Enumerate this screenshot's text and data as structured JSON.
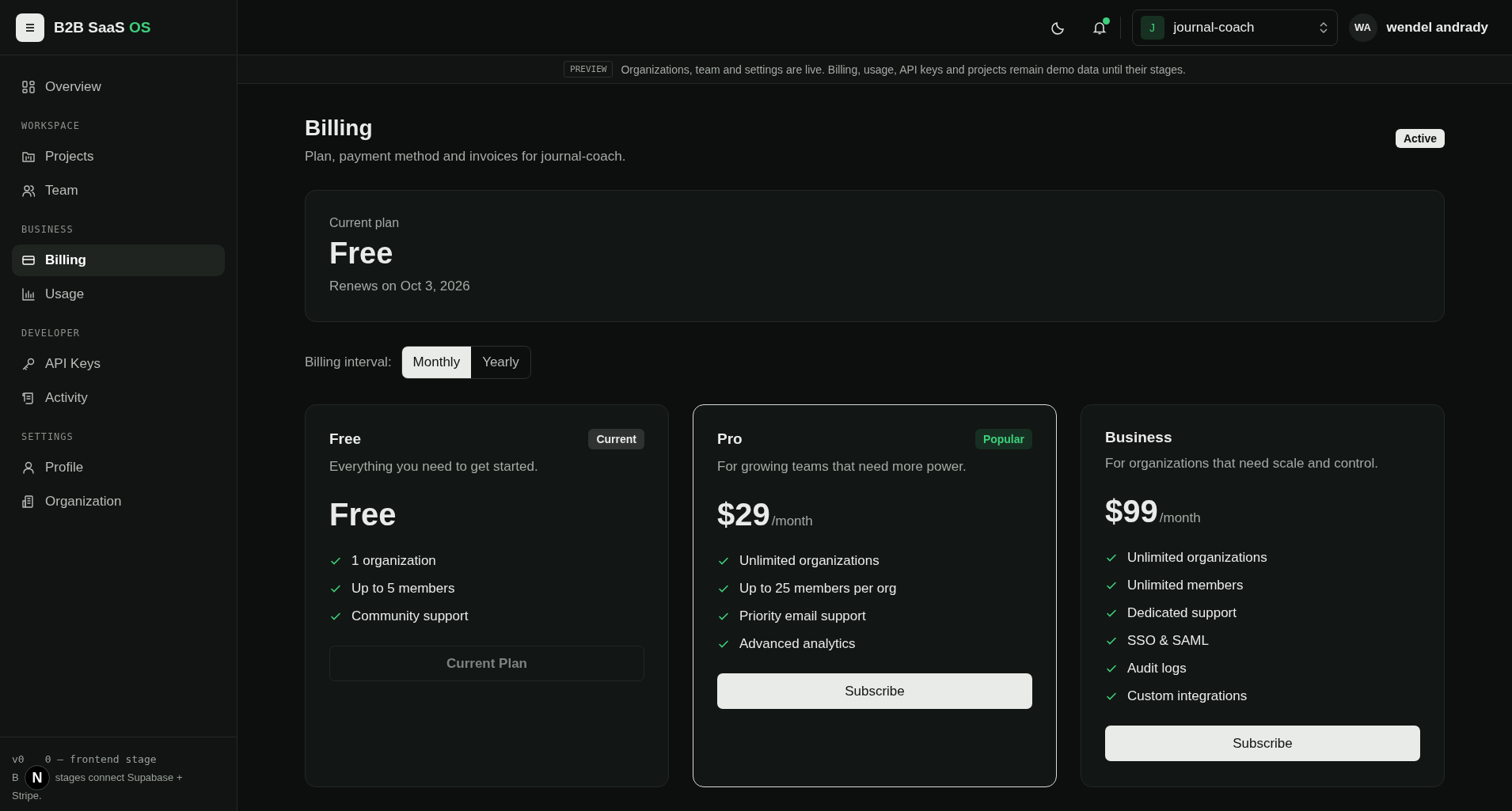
{
  "sidebar": {
    "brand": {
      "name": "B2B SaaS",
      "suffix": "OS"
    },
    "sections": [
      {
        "items": [
          {
            "label": "Overview",
            "selected": false
          }
        ]
      },
      {
        "heading": "WORKSPACE",
        "items": [
          {
            "label": "Projects",
            "selected": false
          },
          {
            "label": "Team",
            "selected": false
          }
        ]
      },
      {
        "heading": "BUSINESS",
        "items": [
          {
            "label": "Billing",
            "selected": true
          },
          {
            "label": "Usage",
            "selected": false
          }
        ]
      },
      {
        "heading": "DEVELOPER",
        "items": [
          {
            "label": "API Keys",
            "selected": false
          },
          {
            "label": "Activity",
            "selected": false
          }
        ]
      },
      {
        "heading": "SETTINGS",
        "items": [
          {
            "label": "Profile",
            "selected": false
          },
          {
            "label": "Organization",
            "selected": false
          }
        ]
      }
    ],
    "footer": {
      "version_parts": [
        "v0",
        "0 — frontend stage"
      ],
      "note_parts": [
        "B",
        "stages connect Supabase +"
      ],
      "note_last": "Stripe."
    },
    "dev_badge": "N"
  },
  "header": {
    "notifications": {
      "unread": true
    },
    "workspace": {
      "initial": "J",
      "name": "journal-coach"
    },
    "user": {
      "initials": "WA",
      "name": "wendel andrady"
    }
  },
  "preview": {
    "tag": "PREVIEW",
    "message": "Organizations, team and settings are live. Billing, usage, API keys and projects remain demo data until their stages."
  },
  "page": {
    "title": "Billing",
    "subtitle": "Plan, payment method and invoices for journal-coach.",
    "status": "Active"
  },
  "current_plan": {
    "label": "Current plan",
    "name": "Free",
    "renewal": "Renews on Oct 3, 2026"
  },
  "interval": {
    "label": "Billing interval:",
    "options": [
      {
        "label": "Monthly",
        "selected": true
      },
      {
        "label": "Yearly",
        "selected": false
      }
    ]
  },
  "plans": [
    {
      "name": "Free",
      "badge": {
        "label": "Current",
        "color": "#e8ebe9"
      },
      "highlighted": false,
      "description": "Everything you need to get started.",
      "price": "Free",
      "features": [
        "1 organization",
        "Up to 5 members",
        "Community support"
      ],
      "button": {
        "label": "Current Plan",
        "disabled": true
      }
    },
    {
      "name": "Pro",
      "badge": {
        "label": "Popular",
        "color": "#3ecf7c"
      },
      "highlighted": true,
      "description": "For growing teams that need more power.",
      "price": "$29",
      "period": "/month",
      "features": [
        "Unlimited organizations",
        "Up to 25 members per org",
        "Priority email support",
        "Advanced analytics"
      ],
      "button": {
        "label": "Subscribe",
        "disabled": false
      }
    },
    {
      "name": "Business",
      "highlighted": false,
      "description": "For organizations that need scale and control.",
      "price": "$99",
      "period": "/month",
      "features": [
        "Unlimited organizations",
        "Unlimited members",
        "Dedicated support",
        "SSO & SAML",
        "Audit logs",
        "Custom integrations"
      ],
      "button": {
        "label": "Subscribe",
        "disabled": false
      }
    }
  ]
}
